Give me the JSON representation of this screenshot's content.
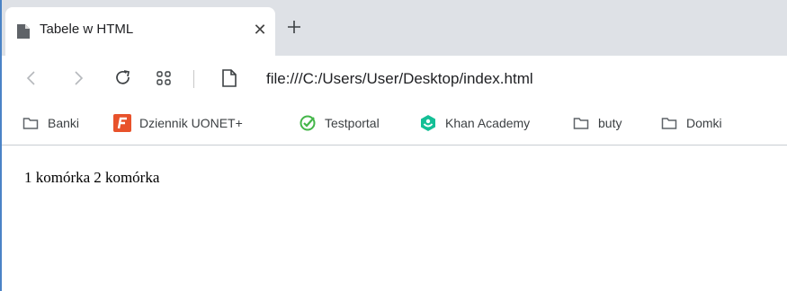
{
  "tab": {
    "title": "Tabele w HTML",
    "close": "✕",
    "new_tab": "+"
  },
  "address_bar": {
    "url": "file:///C:/Users/User/Desktop/index.html"
  },
  "bookmarks": [
    {
      "label": "Banki",
      "icon": "folder-icon"
    },
    {
      "label": "Dziennik UONET+",
      "icon": "uonet-icon"
    },
    {
      "label": "Testportal",
      "icon": "testportal-icon"
    },
    {
      "label": "Khan Academy",
      "icon": "khan-academy-icon"
    },
    {
      "label": "buty",
      "icon": "folder-icon"
    },
    {
      "label": "Domki",
      "icon": "folder-icon"
    }
  ],
  "page": {
    "table_rows": [
      [
        "1 komórka",
        "2 komórka"
      ]
    ]
  },
  "colors": {
    "window_border": "#4a83c6",
    "tabstrip": "#dee1e6",
    "uonet": "#e8522b",
    "testportal": "#44b649",
    "khan": "#14bf96"
  }
}
